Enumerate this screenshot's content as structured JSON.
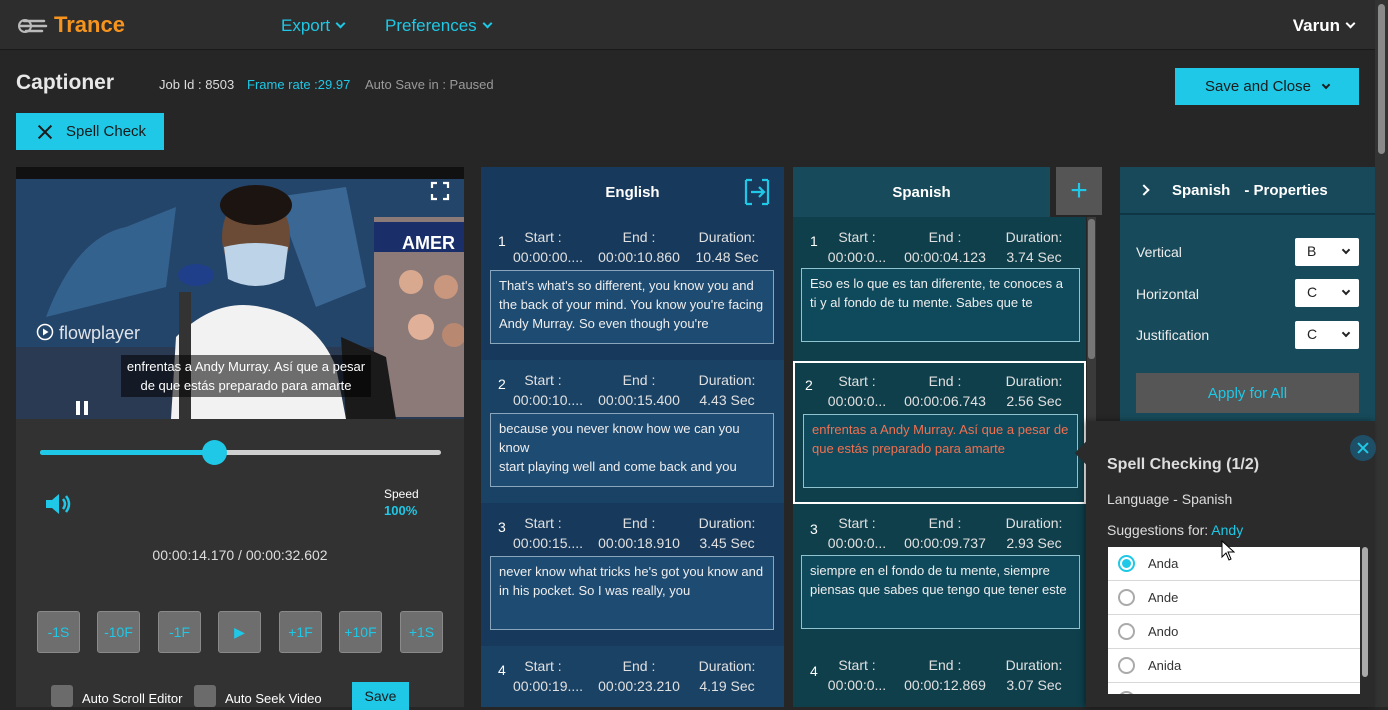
{
  "header": {
    "logo_text": "Trance",
    "menu_export": "Export",
    "menu_preferences": "Preferences",
    "user_name": "Varun"
  },
  "toolbar": {
    "page_title": "Captioner",
    "job_id": "Job Id : 8503",
    "frame_rate": "Frame rate :29.97",
    "autosave": "Auto Save in : Paused",
    "save_close_label": "Save and Close",
    "spell_check_label": "Spell Check"
  },
  "player": {
    "watermark": "flowplayer",
    "caption_line1": "enfrentas a Andy Murray. Así que a pesar",
    "caption_line2": "de que estás preparado para amarte",
    "progress": 0.435,
    "speed_label": "Speed",
    "speed_value": "100%",
    "time": "00:00:14.170 / 00:00:32.602",
    "controls": [
      "-1S",
      "-10F",
      "-1F",
      "▶",
      "+1F",
      "+10F",
      "+1S"
    ],
    "auto_scroll_label": "Auto Scroll Editor",
    "auto_seek_label": "Auto Seek Video",
    "save_label": "Save"
  },
  "english": {
    "header": "English",
    "segments": [
      {
        "num": "1",
        "start": "00:00:00....",
        "end": "00:00:10.860",
        "duration": "10.48 Sec",
        "text": "That's what's so different, you know you and the back of your mind. You know you're facing Andy Murray. So even though you're"
      },
      {
        "num": "2",
        "start": "00:00:10....",
        "end": "00:00:15.400",
        "duration": "4.43 Sec",
        "text": "because you never know how we can you know\nstart playing well and come back and you"
      },
      {
        "num": "3",
        "start": "00:00:15....",
        "end": "00:00:18.910",
        "duration": "3.45 Sec",
        "text": "never know what tricks he's got you know and in his pocket. So I was really, you"
      },
      {
        "num": "4",
        "start": "00:00:19....",
        "end": "00:00:23.210",
        "duration": "4.19 Sec",
        "text": ""
      }
    ]
  },
  "spanish": {
    "header": "Spanish",
    "segments": [
      {
        "num": "1",
        "start": "00:00:0...",
        "end": "00:00:04.123",
        "duration": "3.74 Sec",
        "text": "Eso es lo que es tan diferente, te conoces a ti y al fondo de tu mente. Sabes que te"
      },
      {
        "num": "2",
        "start": "00:00:0...",
        "end": "00:00:06.743",
        "duration": "2.56 Sec",
        "text": "enfrentas a Andy Murray. Así que a pesar de que estás preparado para amarte"
      },
      {
        "num": "3",
        "start": "00:00:0...",
        "end": "00:00:09.737",
        "duration": "2.93 Sec",
        "text": "siempre en el fondo de tu mente, siempre piensas que sabes que tengo que tener este"
      },
      {
        "num": "4",
        "start": "00:00:0...",
        "end": "00:00:12.869",
        "duration": "3.07 Sec",
        "text": ""
      }
    ]
  },
  "labels": {
    "start": "Start :",
    "end": "End :",
    "duration": "Duration:"
  },
  "properties": {
    "title_lang": "Spanish",
    "title_suffix": "- Properties",
    "vertical_label": "Vertical",
    "vertical_value": "B",
    "horizontal_label": "Horizontal",
    "horizontal_value": "C",
    "justification_label": "Justification",
    "justification_value": "C",
    "apply_all": "Apply for All"
  },
  "spell_popup": {
    "title": "Spell Checking (1/2)",
    "language": "Language - Spanish",
    "suggestions_prefix": "Suggestions for: ",
    "word": "Andy",
    "suggestions": [
      "Anda",
      "Ande",
      "Ando",
      "Anida"
    ],
    "selected_index": 0
  },
  "colors": {
    "accent": "#1ec8e6",
    "brand": "#f7941d",
    "english_bg": "#173a5c",
    "spanish_bg": "#0f3f4b"
  }
}
